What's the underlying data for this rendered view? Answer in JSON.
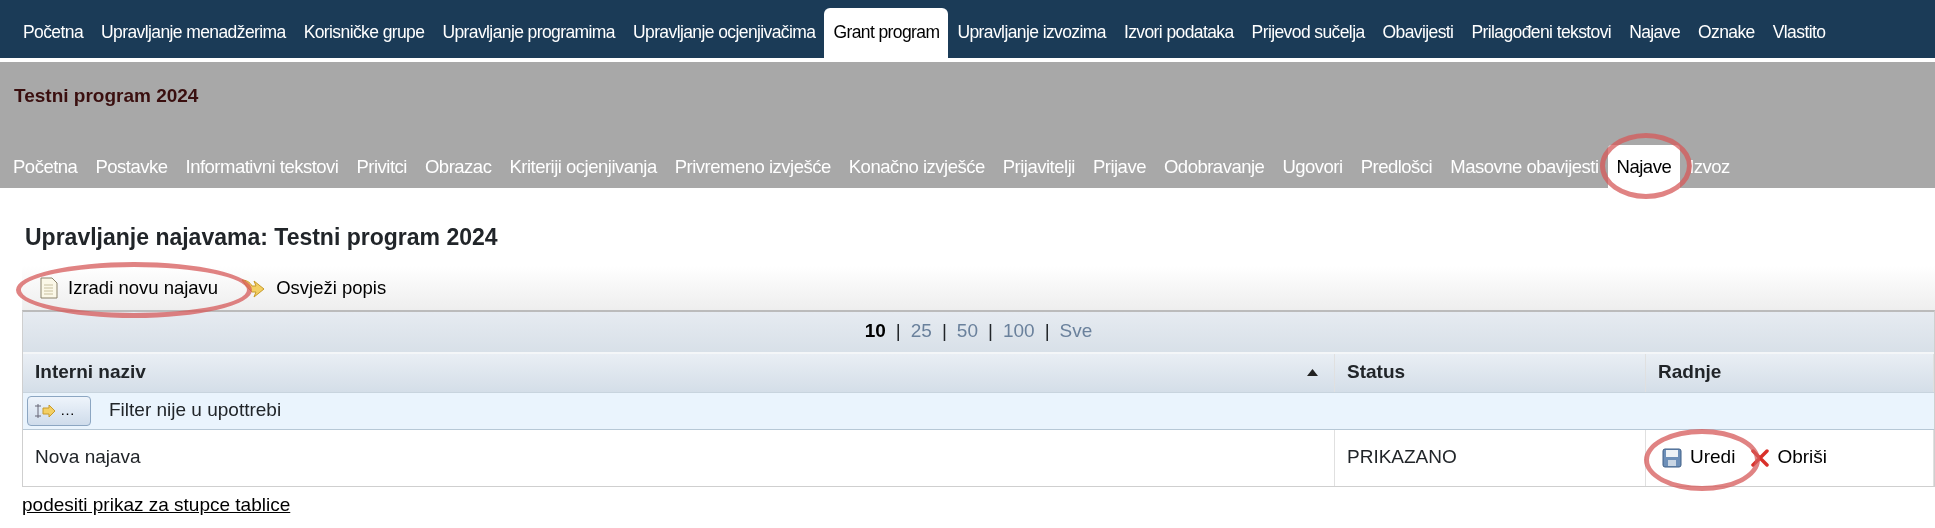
{
  "top_nav": [
    {
      "label": "Početna",
      "selected": false
    },
    {
      "label": "Upravljanje menadžerima",
      "selected": false
    },
    {
      "label": "Korisničke grupe",
      "selected": false
    },
    {
      "label": "Upravljanje programima",
      "selected": false
    },
    {
      "label": "Upravljanje ocjenjivačima",
      "selected": false
    },
    {
      "label": "Grant program",
      "selected": true
    },
    {
      "label": "Upravljanje izvozima",
      "selected": false
    },
    {
      "label": "Izvori podataka",
      "selected": false
    },
    {
      "label": "Prijevod sučelja",
      "selected": false
    },
    {
      "label": "Obavijesti",
      "selected": false
    },
    {
      "label": "Prilagođeni tekstovi",
      "selected": false
    },
    {
      "label": "Najave",
      "selected": false
    },
    {
      "label": "Oznake",
      "selected": false
    },
    {
      "label": "Vlastito",
      "selected": false
    }
  ],
  "program_title": "Testni program 2024",
  "sub_nav": [
    {
      "label": "Početna",
      "selected": false,
      "highlighted": false
    },
    {
      "label": "Postavke",
      "selected": false,
      "highlighted": false
    },
    {
      "label": "Informativni tekstovi",
      "selected": false,
      "highlighted": false
    },
    {
      "label": "Privitci",
      "selected": false,
      "highlighted": false
    },
    {
      "label": "Obrazac",
      "selected": false,
      "highlighted": false
    },
    {
      "label": "Kriteriji ocjenjivanja",
      "selected": false,
      "highlighted": false
    },
    {
      "label": "Privremeno izvješće",
      "selected": false,
      "highlighted": false
    },
    {
      "label": "Konačno izvješće",
      "selected": false,
      "highlighted": false
    },
    {
      "label": "Prijavitelji",
      "selected": false,
      "highlighted": false
    },
    {
      "label": "Prijave",
      "selected": false,
      "highlighted": false
    },
    {
      "label": "Odobravanje",
      "selected": false,
      "highlighted": false
    },
    {
      "label": "Ugovori",
      "selected": false,
      "highlighted": false
    },
    {
      "label": "Predlošci",
      "selected": false,
      "highlighted": false
    },
    {
      "label": "Masovne obavijesti",
      "selected": false,
      "highlighted": false
    },
    {
      "label": "Najave",
      "selected": true,
      "highlighted": true
    },
    {
      "label": "Izvoz",
      "selected": false,
      "highlighted": false
    }
  ],
  "page_title": "Upravljanje najavama: Testni program 2024",
  "toolbar": [
    {
      "label": "Izradi novu najavu",
      "kind": "new",
      "highlighted": true
    },
    {
      "label": "Osvježi popis",
      "kind": "refresh",
      "highlighted": false
    }
  ],
  "table": {
    "pager_separator": "|",
    "pager": [
      {
        "label": "10",
        "selected": true
      },
      {
        "label": "25",
        "selected": false
      },
      {
        "label": "50",
        "selected": false
      },
      {
        "label": "100",
        "selected": false
      },
      {
        "label": "Sve",
        "selected": false
      }
    ],
    "columns": [
      {
        "label": "Interni naziv",
        "sorted": true
      },
      {
        "label": "Status",
        "sorted": false
      },
      {
        "label": "Radnje",
        "sorted": false
      }
    ],
    "filter": {
      "button_label": "…",
      "text": "Filter nije u upottrebi"
    },
    "rows": [
      {
        "cells": [
          "Nova najava",
          "PRIKAZANO"
        ],
        "actions": [
          {
            "label": "Uredi",
            "kind": "edit",
            "highlighted": true
          },
          {
            "label": "Obriši",
            "kind": "delete",
            "highlighted": false
          }
        ]
      }
    ]
  },
  "footer_link": "podesiti prikaz za stupce tablice"
}
